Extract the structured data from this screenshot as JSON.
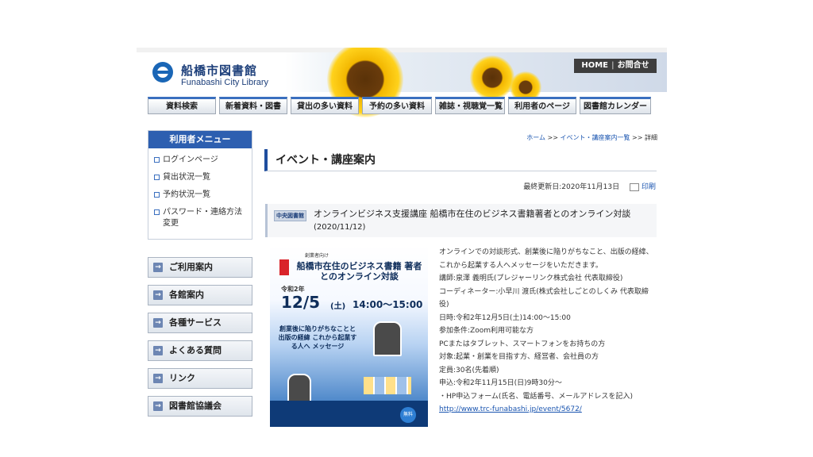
{
  "header": {
    "site_title": "船橋市図書館",
    "site_subtitle": "Funabashi City Library",
    "home_link": "HOME",
    "contact_link": "お問合せ"
  },
  "nav": [
    {
      "label": "資料検索"
    },
    {
      "label": "新着資料・図書"
    },
    {
      "label": "貸出の多い資料"
    },
    {
      "label": "予約の多い資料"
    },
    {
      "label": "雑誌・視聴覚一覧"
    },
    {
      "label": "利用者のページ"
    },
    {
      "label": "図書館カレンダー"
    }
  ],
  "user_menu": {
    "title": "利用者メニュー",
    "items": [
      {
        "label": "ログインページ"
      },
      {
        "label": "貸出状況一覧"
      },
      {
        "label": "予約状況一覧"
      },
      {
        "label": "パスワード・連絡方法変更"
      }
    ]
  },
  "side_buttons": [
    {
      "label": "ご利用案内"
    },
    {
      "label": "各館案内"
    },
    {
      "label": "各種サービス"
    },
    {
      "label": "よくある質問"
    },
    {
      "label": "リンク"
    },
    {
      "label": "図書館協議会"
    }
  ],
  "breadcrumb": {
    "home": "ホーム",
    "sep": ">>",
    "events": "イベント・講座案内一覧",
    "current": "詳細"
  },
  "page_title": "イベント・講座案内",
  "updated": "最終更新日:2020年11月13日",
  "print_label": "印刷",
  "event": {
    "branch": "中央図書館",
    "title": "オンラインビジネス支援講座 船橋市在住のビジネス書籍著者とのオンライン対談",
    "date": "(2020/11/12)"
  },
  "flyer": {
    "small": "創業者向け",
    "title": "船橋市在住のビジネス書籍 著者とのオンライン対談",
    "year": "令和2年",
    "date": "12/5",
    "day": "(土)",
    "time": "14:00〜15:00",
    "message": "創業後に陥りがちなことと 出版の経緯 これから起業する人へ メッセージ",
    "badge": "無料"
  },
  "details": [
    "オンラインでの対談形式、創業後に陥りがちなこと、出版の経緯、これから起業する人へメッセージをいただきます。",
    "講師:泉澤 義明氏(プレジャーリンク株式会社 代表取締役)",
    "コーディネーター:小早川 渡氏(株式会社しごとのしくみ 代表取締役)",
    "日時:令和2年12月5日(土)14:00〜15:00",
    "参加条件:Zoom利用可能な方",
    "PCまたはタブレット、スマートフォンをお持ちの方",
    "対象:起業・創業を目指す方、経営者、会社員の方",
    "定員:30名(先着順)",
    "申込:令和2年11月15日(日)9時30分〜",
    "・HP申込フォーム(氏名、電話番号、メールアドレスを記入)"
  ],
  "details_link": "http://www.trc-funabashi.jp/event/5672/",
  "colors": {
    "accent": "#2d5fb0",
    "title_border": "#1f4e9e",
    "link": "#1a55b0"
  }
}
